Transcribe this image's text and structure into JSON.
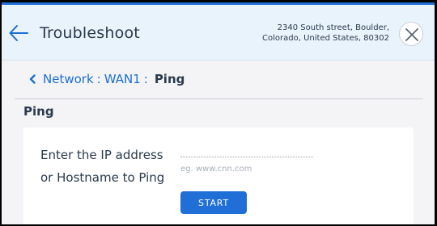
{
  "colors": {
    "accent": "#1b6fd3",
    "header_bg": "#e9f3fb",
    "button_bg": "#1f6fd6",
    "text": "#2a3a4d"
  },
  "header": {
    "back_icon": "arrow-left-icon",
    "title": "Troubleshoot",
    "address_line1": "2340 South street, Boulder,",
    "address_line2": "Colorado, United States, 80302",
    "close_icon": "close-icon"
  },
  "breadcrumb": {
    "icon": "chevron-left-icon",
    "items": [
      "Network",
      "WAN1"
    ],
    "separator": ":",
    "current": "Ping"
  },
  "section": {
    "title": "Ping"
  },
  "form": {
    "prompt_line1": "Enter the IP address",
    "prompt_line2": "or Hostname to Ping",
    "input_value": "",
    "input_placeholder": "eg. www.cnn.com",
    "start_label": "START"
  }
}
